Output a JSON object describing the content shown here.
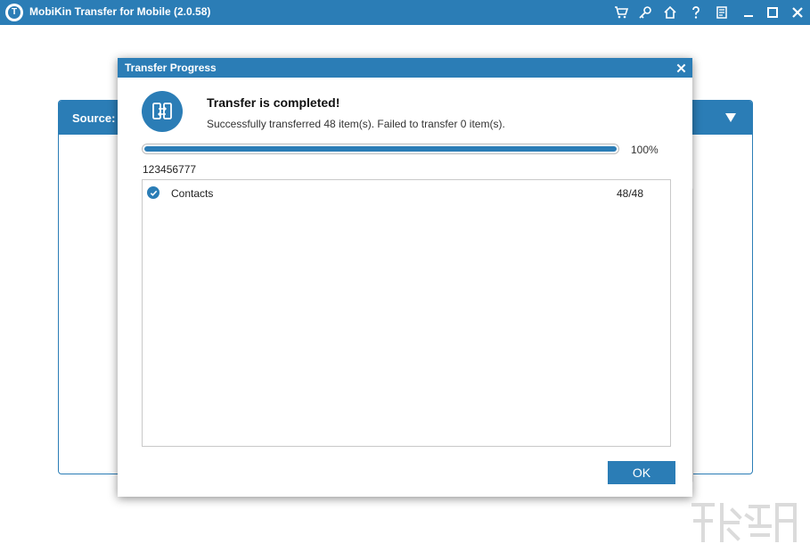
{
  "window": {
    "title": "MobiKin Transfer for Mobile  (2.0.58)",
    "logo_letter": "T",
    "toolbar_icons": [
      "cart-icon",
      "key-icon",
      "home-icon",
      "help-icon",
      "feedback-icon",
      "minimize-icon",
      "maximize-icon",
      "close-icon"
    ]
  },
  "source_panel": {
    "label": "Source:"
  },
  "dialog": {
    "title": "Transfer Progress",
    "close_glyph": "x",
    "status_title": "Transfer is completed!",
    "status_message": "Successfully transferred 48 item(s). Failed to transfer 0 item(s).",
    "progress": {
      "value": 1.0,
      "label": "100%"
    },
    "device_name": "123456777",
    "items": [
      {
        "name": "Contacts",
        "count": "48/48",
        "checked": true
      }
    ],
    "ok_label": "OK"
  },
  "colors": {
    "accent": "#2b7db6",
    "background": "#ffffff"
  }
}
